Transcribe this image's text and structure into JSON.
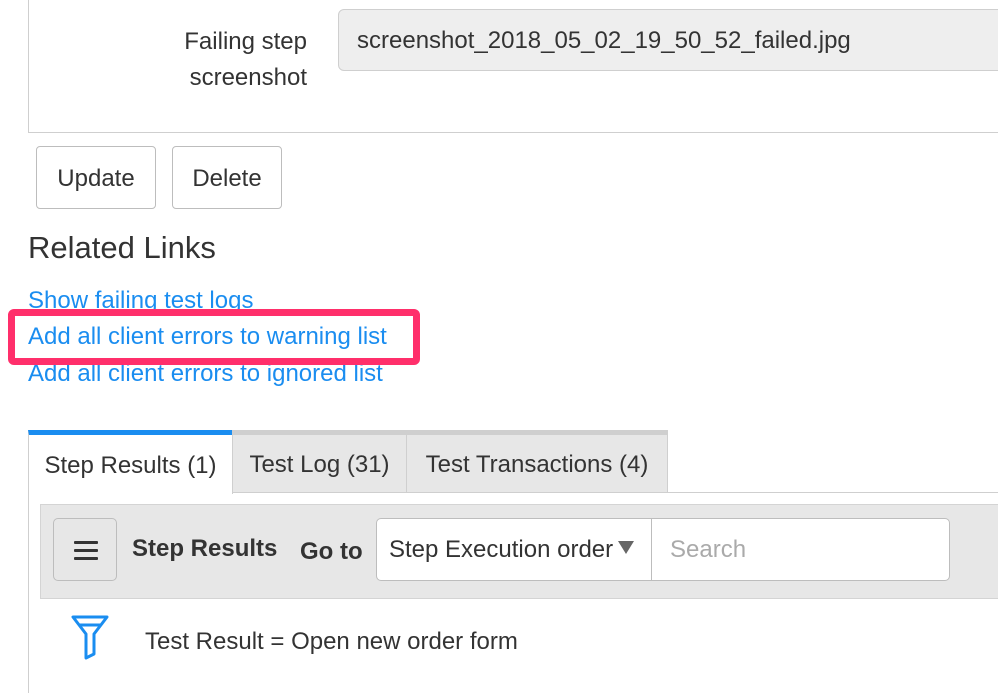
{
  "form": {
    "field_label": "Failing step screenshot",
    "field_value": "screenshot_2018_05_02_19_50_52_failed.jpg"
  },
  "actions": {
    "update_label": "Update",
    "delete_label": "Delete"
  },
  "related_links": {
    "title": "Related Links",
    "items": [
      {
        "label": "Show failing test logs"
      },
      {
        "label": "Add all client errors to warning list"
      },
      {
        "label": "Add all client errors to ignored list"
      }
    ]
  },
  "tabs": [
    {
      "label": "Step Results (1)",
      "active": true
    },
    {
      "label": "Test Log (31)",
      "active": false
    },
    {
      "label": "Test Transactions (4)",
      "active": false
    }
  ],
  "list_toolbar": {
    "menu_icon": "hamburger-icon",
    "title": "Step Results",
    "goto_label": "Go to",
    "goto_selected": "Step Execution order",
    "search_placeholder": "Search"
  },
  "filter": {
    "icon": "filter-icon",
    "text": "Test Result = Open new order form"
  },
  "colors": {
    "link": "#1a8df0",
    "highlight": "#ff2f6b",
    "tab_active_accent": "#1a8df0",
    "toolbar_bg": "#e7e7e7"
  }
}
